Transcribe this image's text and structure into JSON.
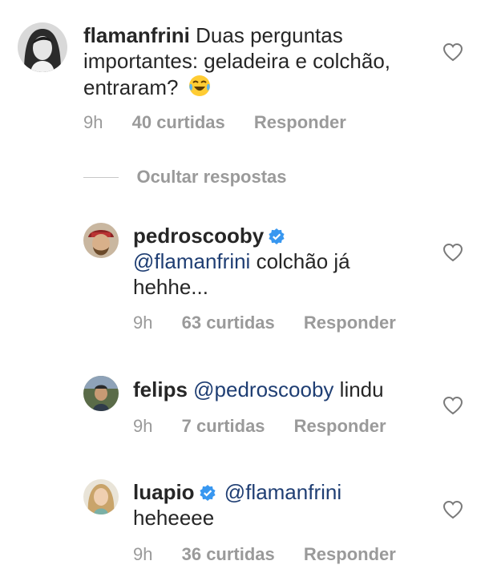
{
  "comments": [
    {
      "username": "flamanfrini",
      "text": "Duas perguntas importantes: geladeira e colchão, entraram?",
      "emoji": "face-with-tears-of-joy",
      "time": "9h",
      "likes": "40 curtidas",
      "reply": "Responder"
    }
  ],
  "hide_replies": "Ocultar respostas",
  "replies": [
    {
      "username": "pedroscooby",
      "verified": true,
      "mention": "@flamanfrini",
      "text": "colchão já hehhe...",
      "time": "9h",
      "likes": "63 curtidas",
      "reply": "Responder"
    },
    {
      "username": "felips",
      "verified": false,
      "mention": "@pedroscooby",
      "text": "lindu",
      "time": "9h",
      "likes": "7 curtidas",
      "reply": "Responder"
    },
    {
      "username": "luapio",
      "verified": true,
      "mention": "@flamanfrini",
      "text": "heheeee",
      "time": "9h",
      "likes": "36 curtidas",
      "reply": "Responder"
    }
  ],
  "colors": {
    "mention": "#1f3e73",
    "verified": "#3897f0",
    "meta": "#9a9a9a"
  }
}
